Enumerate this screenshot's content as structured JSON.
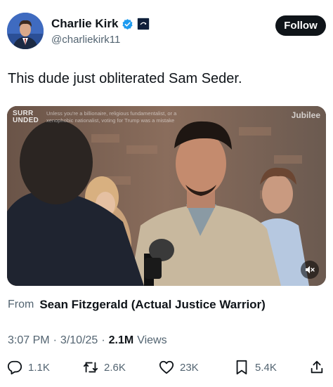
{
  "author": {
    "display_name": "Charlie Kirk",
    "handle": "@charliekirk11",
    "verified_icon": "verified-check-icon",
    "affiliate_badge": "affiliate-badge-icon"
  },
  "follow_label": "Follow",
  "tweet_text": "This dude just obliterated Sam Seder.",
  "media": {
    "logo_text": "SURR●UNDED",
    "logo_line1": "SURR",
    "logo_line2": "UNDED",
    "caption": "Unless you're a billionaire, religious fundamentalist, or a xenophobic nationalist, voting for Trump was a mistake",
    "watermark": "Jubilee",
    "mute_icon": "speaker-muted-icon"
  },
  "source": {
    "label": "From",
    "name": "Sean Fitzgerald (Actual Justice Warrior)"
  },
  "meta": {
    "time": "3:07 PM",
    "date": "3/10/25",
    "views_count": "2.1M",
    "views_label": "Views",
    "separator": "·"
  },
  "actions": {
    "replies": "1.1K",
    "reposts": "2.6K",
    "likes": "23K",
    "bookmarks": "5.4K"
  },
  "colors": {
    "text_primary": "#0f1419",
    "text_secondary": "#536471",
    "verified_blue": "#1d9bf0",
    "follow_bg": "#0f1419"
  }
}
